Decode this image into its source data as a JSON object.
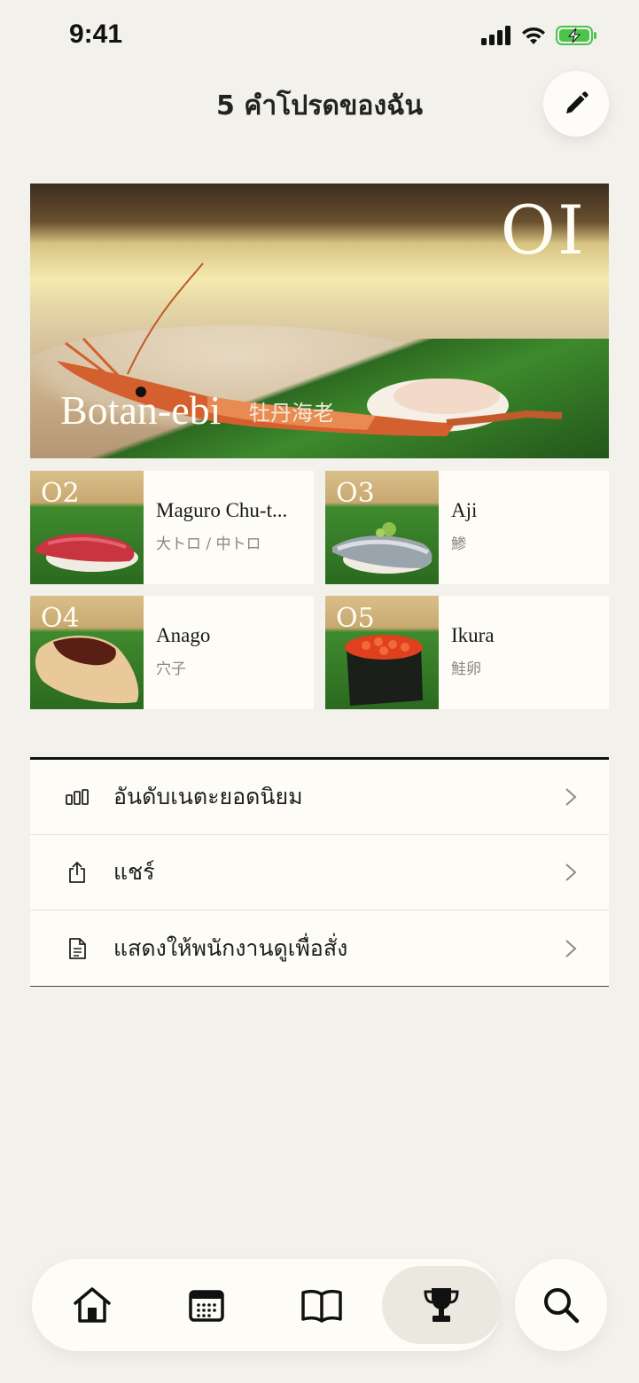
{
  "status": {
    "time": "9:41"
  },
  "header": {
    "title": "5 คำโปรดของฉัน",
    "edit_icon": "pencil-icon"
  },
  "hero": {
    "rank": "OI",
    "name": "Botan-ebi",
    "name_jp": "牡丹海老"
  },
  "favorites": [
    {
      "rank": "O2",
      "name": "Maguro Chu-t...",
      "name_jp": "大トロ / 中トロ"
    },
    {
      "rank": "O3",
      "name": "Aji",
      "name_jp": "鯵"
    },
    {
      "rank": "O4",
      "name": "Anago",
      "name_jp": "穴子"
    },
    {
      "rank": "O5",
      "name": "Ikura",
      "name_jp": "鮭卵"
    }
  ],
  "menu": [
    {
      "label": "อันดับเนตะยอดนิยม",
      "icon": "ranking-bars-icon"
    },
    {
      "label": "แชร์",
      "icon": "share-icon"
    },
    {
      "label": "แสดงให้พนักงานดูเพื่อสั่ง",
      "icon": "document-icon"
    }
  ],
  "tabbar": {
    "tabs": [
      "home-icon",
      "calendar-icon",
      "book-icon",
      "trophy-icon"
    ],
    "active_tab": "trophy-icon",
    "search_icon": "search-icon"
  },
  "colors": {
    "background": "#f3f1ec",
    "card": "#fdfcf7",
    "active_tab": "#ebe8df"
  }
}
